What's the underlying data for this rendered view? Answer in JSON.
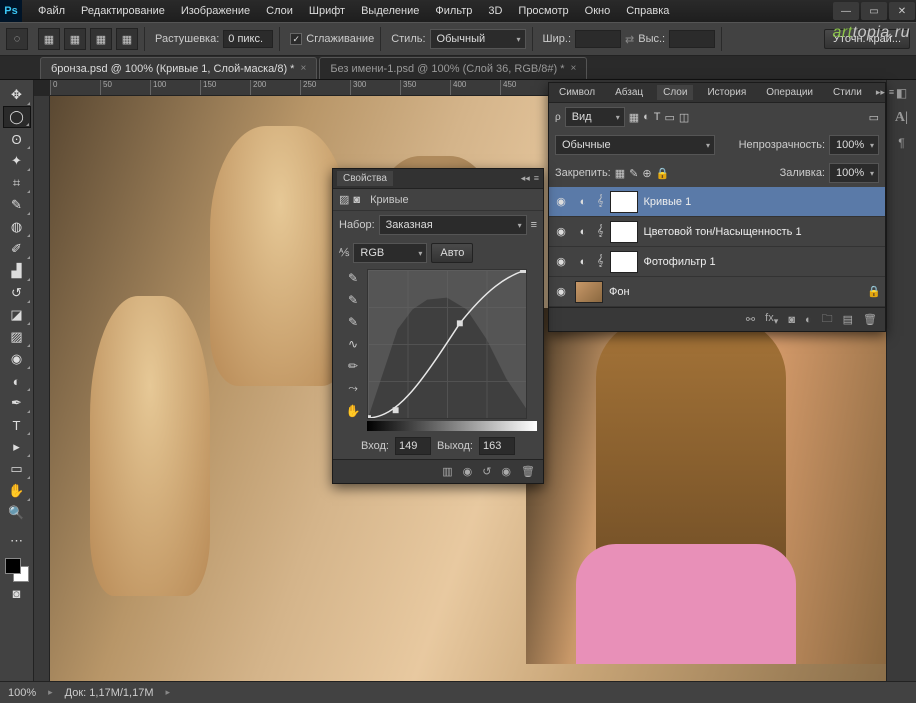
{
  "menu": [
    "Файл",
    "Редактирование",
    "Изображение",
    "Слои",
    "Шрифт",
    "Выделение",
    "Фильтр",
    "3D",
    "Просмотр",
    "Окно",
    "Справка"
  ],
  "watermark": {
    "left": "art",
    "right": "topia.ru"
  },
  "options": {
    "feather_label": "Растушевка:",
    "feather_value": "0 пикс.",
    "antialias_label": "Сглаживание",
    "style_label": "Стиль:",
    "style_value": "Обычный",
    "width_label": "Шир.:",
    "height_label": "Выс.:",
    "refine_label": "Уточн. край..."
  },
  "tabs": [
    "бронза.psd @ 100% (Кривые 1, Слой-маска/8) *",
    "Без имени-1.psd @ 100% (Слой 36, RGB/8#) *"
  ],
  "ruler_marks": [
    "0",
    "50",
    "100",
    "150",
    "200",
    "250",
    "300",
    "350",
    "400",
    "450"
  ],
  "layers_panel": {
    "tabs": [
      "Символ",
      "Абзац",
      "Слои",
      "История",
      "Операции",
      "Стили"
    ],
    "kind_label": "Вид",
    "blend_mode": "Обычные",
    "opacity_label": "Непрозрачность:",
    "opacity_value": "100%",
    "lock_label": "Закрепить:",
    "fill_label": "Заливка:",
    "fill_value": "100%",
    "layers": [
      {
        "name": "Кривые 1",
        "selected": true,
        "adj": true
      },
      {
        "name": "Цветовой тон/Насыщенность 1",
        "selected": false,
        "adj": true
      },
      {
        "name": "Фотофильтр 1",
        "selected": false,
        "adj": true
      },
      {
        "name": "Фон",
        "selected": false,
        "adj": false
      }
    ]
  },
  "properties": {
    "title": "Свойства",
    "subtitle": "Кривые",
    "preset_label": "Набор:",
    "preset_value": "Заказная",
    "channel_value": "RGB",
    "auto_label": "Авто",
    "input_label": "Вход:",
    "input_value": "149",
    "output_label": "Выход:",
    "output_value": "163"
  },
  "status": {
    "zoom": "100%",
    "doc_label": "Док:",
    "doc_value": "1,17M/1,17M"
  },
  "chart_data": {
    "type": "line",
    "title": "Кривые",
    "xlabel": "Вход",
    "ylabel": "Выход",
    "xlim": [
      0,
      255
    ],
    "ylim": [
      0,
      255
    ],
    "series": [
      {
        "name": "RGB",
        "values": [
          [
            0,
            0
          ],
          [
            44,
            14
          ],
          [
            149,
            163
          ],
          [
            255,
            255
          ]
        ]
      }
    ],
    "current_point": {
      "input": 149,
      "output": 163
    }
  }
}
